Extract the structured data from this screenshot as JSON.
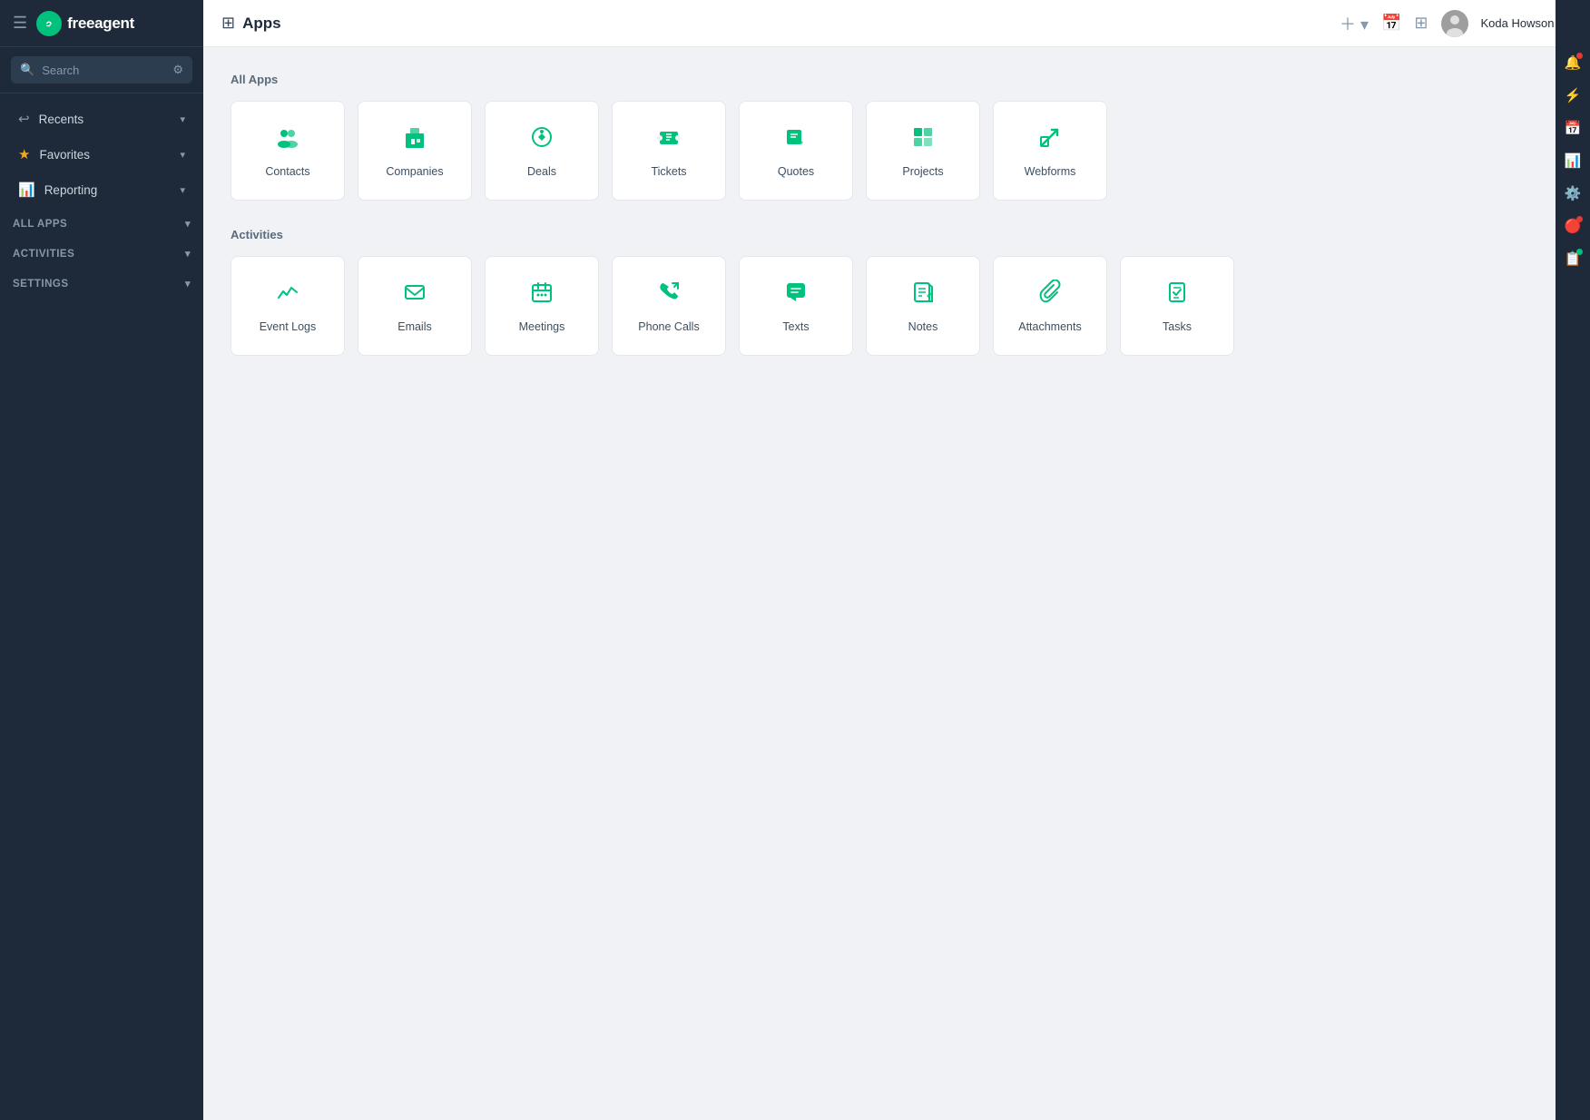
{
  "app": {
    "logo_text": "freeagent",
    "logo_symbol": "fa"
  },
  "sidebar": {
    "search_placeholder": "Search",
    "nav_items": [
      {
        "id": "recents",
        "label": "Recents",
        "icon": "↩",
        "has_arrow": true
      },
      {
        "id": "favorites",
        "label": "Favorites",
        "icon": "★",
        "has_arrow": true
      },
      {
        "id": "reporting",
        "label": "Reporting",
        "icon": "📊",
        "has_arrow": true
      }
    ],
    "sections": [
      {
        "id": "all-apps",
        "label": "ALL APPS",
        "has_arrow": true
      },
      {
        "id": "activities",
        "label": "ACTIVITIES",
        "has_arrow": true
      },
      {
        "id": "settings",
        "label": "SETTINGS",
        "has_arrow": true
      }
    ]
  },
  "topbar": {
    "title": "Apps",
    "user_name": "Koda Howson"
  },
  "main": {
    "all_apps_section_title": "All Apps",
    "all_apps": [
      {
        "id": "contacts",
        "label": "Contacts",
        "icon": "👥"
      },
      {
        "id": "companies",
        "label": "Companies",
        "icon": "🏢"
      },
      {
        "id": "deals",
        "label": "Deals",
        "icon": "🎯"
      },
      {
        "id": "tickets",
        "label": "Tickets",
        "icon": "🎫"
      },
      {
        "id": "quotes",
        "label": "Quotes",
        "icon": "💬"
      },
      {
        "id": "projects",
        "label": "Projects",
        "icon": "📁"
      },
      {
        "id": "webforms",
        "label": "Webforms",
        "icon": "✏️"
      }
    ],
    "activities_section_title": "Activities",
    "activities": [
      {
        "id": "event-logs",
        "label": "Event Logs",
        "icon": "📈"
      },
      {
        "id": "emails",
        "label": "Emails",
        "icon": "✉️"
      },
      {
        "id": "meetings",
        "label": "Meetings",
        "icon": "📅"
      },
      {
        "id": "phone-calls",
        "label": "Phone Calls",
        "icon": "📞"
      },
      {
        "id": "texts",
        "label": "Texts",
        "icon": "💬"
      },
      {
        "id": "notes",
        "label": "Notes",
        "icon": "📝"
      },
      {
        "id": "attachments",
        "label": "Attachments",
        "icon": "📎"
      },
      {
        "id": "tasks",
        "label": "Tasks",
        "icon": "✅"
      }
    ]
  },
  "right_panel": {
    "icons": [
      {
        "id": "notification",
        "symbol": "🔔",
        "has_red_dot": true
      },
      {
        "id": "activity",
        "symbol": "⚡",
        "has_dot": false
      },
      {
        "id": "calendar",
        "symbol": "📅",
        "has_dot": false
      },
      {
        "id": "chart",
        "symbol": "📊",
        "has_dot": false
      },
      {
        "id": "filter",
        "symbol": "⚙️",
        "has_dot": false
      },
      {
        "id": "alert",
        "symbol": "🔴",
        "has_red_dot": false
      },
      {
        "id": "document",
        "symbol": "📋",
        "has_dot": true
      }
    ]
  }
}
